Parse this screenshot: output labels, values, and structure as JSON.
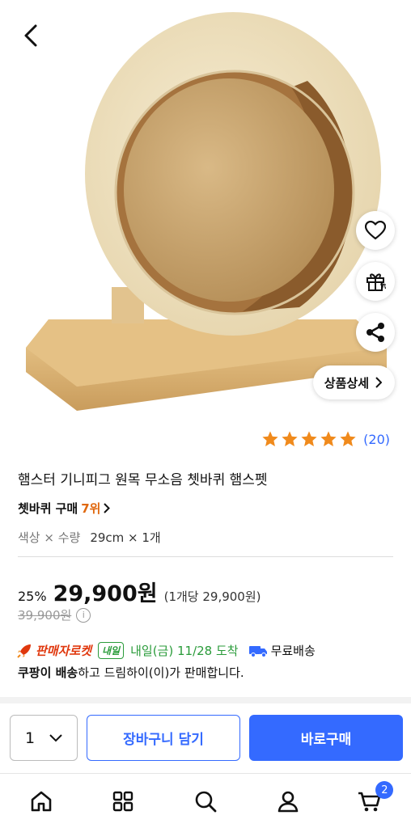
{
  "colors": {
    "accent": "#346aff",
    "rank": "#e0680e",
    "star": "#f08a1c",
    "rocket": "#e0380e",
    "delivery_green": "#2a9b3a"
  },
  "header": {
    "back_icon": "chevron-left-icon"
  },
  "hero": {
    "actions": {
      "wishlist_icon": "heart-icon",
      "gift_icon": "gift-icon",
      "share_icon": "share-icon"
    },
    "detail_button_label": "상품상세"
  },
  "rating": {
    "stars": 5,
    "count_label": "(20)"
  },
  "product": {
    "title": "햄스터 기니피그 원목 무소음 쳇바퀴 햄스펫",
    "rank_category": "쳇바퀴 구매",
    "rank_value": "7위",
    "option_label": "색상 × 수량",
    "option_value": "29cm × 1개"
  },
  "price": {
    "discount": "25%",
    "sale_price": "29,900원",
    "unit_price": "(1개당 29,900원)",
    "original_price": "39,900원"
  },
  "delivery": {
    "brand": "판매자로켓",
    "badge": "내일",
    "arrival": "내일(금) 11/28 도착",
    "free_shipping": "무료배송",
    "seller_bold": "쿠팡이 배송",
    "seller_rest": "하고 드림하이(이)가 판매합니다."
  },
  "purchase": {
    "quantity": "1",
    "add_to_cart_label": "장바구니 담기",
    "buy_now_label": "바로구매"
  },
  "bottom_nav": {
    "items": [
      "home-icon",
      "category-grid-icon",
      "search-icon",
      "user-icon",
      "cart-icon"
    ],
    "cart_count": "2"
  }
}
